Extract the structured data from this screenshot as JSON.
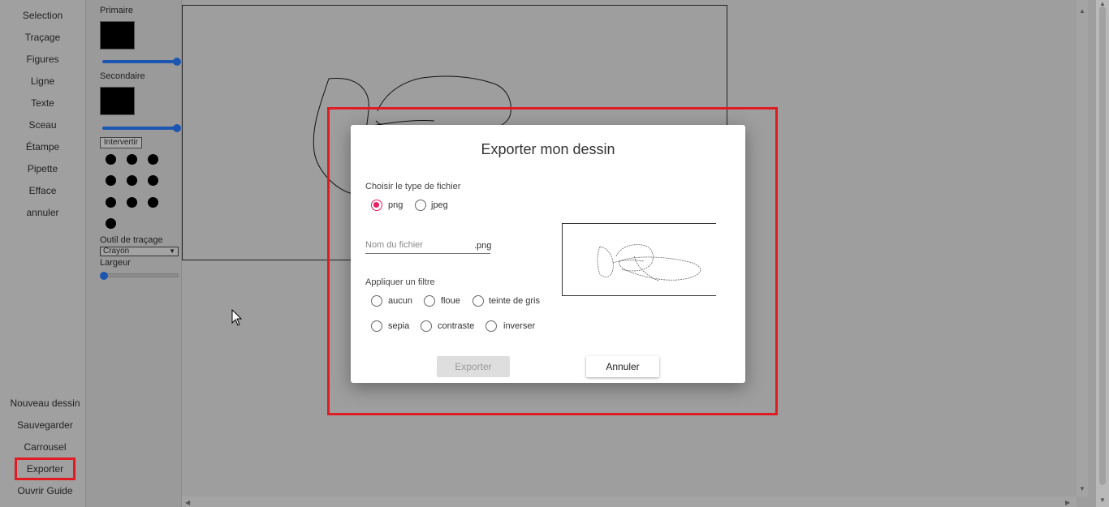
{
  "sidebar": {
    "tools": [
      "Selection",
      "Traçage",
      "Figures",
      "Ligne",
      "Texte",
      "Sceau",
      "Étampe",
      "Pipette",
      "Efface",
      "annuler"
    ],
    "bottom": [
      "Nouveau dessin",
      "Sauvegarder",
      "Carrousel",
      "Exporter",
      "Ouvrir Guide"
    ]
  },
  "attributes": {
    "primary_label": "Primaire",
    "secondary_label": "Secondaire",
    "swap_label": "Intervertir",
    "tool_label": "Outil de traçage",
    "tool_value": "Crayon",
    "width_label": "Largeur"
  },
  "dialog": {
    "title": "Exporter mon dessin",
    "file_type_label": "Choisir le type de fichier",
    "file_types": [
      "png",
      "jpeg"
    ],
    "selected_file_type": "png",
    "filename_placeholder": "Nom du fichier",
    "filename_suffix": ".png",
    "filter_label": "Appliquer un filtre",
    "filters": [
      "aucun",
      "floue",
      "teinte de gris",
      "sepia",
      "contraste",
      "inverser"
    ],
    "export_label": "Exporter",
    "cancel_label": "Annuler"
  },
  "colors": {
    "highlight": "#e01b24",
    "accent": "#e91e63",
    "slider": "#1d56b0",
    "overlay": "#9e9e9e"
  }
}
